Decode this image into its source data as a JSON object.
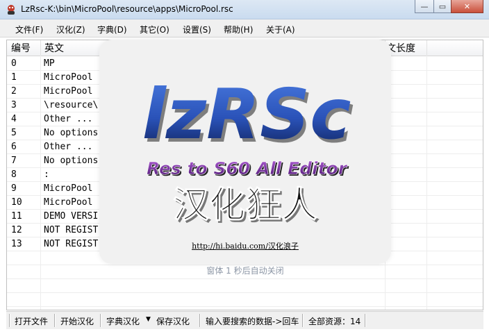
{
  "window": {
    "title": "LzRsc-K:\\bin\\MicroPool\\resource\\apps\\MicroPool.rsc",
    "icon": "lzrsc-app-icon"
  },
  "menu": [
    "文件(F)",
    "汉化(Z)",
    "字典(D)",
    "其它(O)",
    "设置(S)",
    "帮助(H)",
    "关于(A)"
  ],
  "table": {
    "headers": [
      "编号",
      "英文",
      "文长度"
    ],
    "rows": [
      {
        "id": "0",
        "en": "MP"
      },
      {
        "id": "1",
        "en": "MicroPool"
      },
      {
        "id": "2",
        "en": "MicroPool"
      },
      {
        "id": "3",
        "en": "\\resource\\"
      },
      {
        "id": "4",
        "en": "Other ..."
      },
      {
        "id": "5",
        "en": "No options"
      },
      {
        "id": "6",
        "en": "Other ..."
      },
      {
        "id": "7",
        "en": "No options"
      },
      {
        "id": "8",
        "en": ":"
      },
      {
        "id": "9",
        "en": "MicroPool"
      },
      {
        "id": "10",
        "en": "MicroPool"
      },
      {
        "id": "11",
        "en": "DEMO VERSI"
      },
      {
        "id": "12",
        "en": "NOT REGIST"
      },
      {
        "id": "13",
        "en": "NOT REGIST"
      }
    ]
  },
  "splash": {
    "logo": "lzRSc",
    "subtitle": "Res to S60 All Editor",
    "brand": "汉化狂人",
    "link": "http://hi.baidu.com/汉化浪子",
    "close_hint": "窗体 1 秒后自动关闭"
  },
  "status": {
    "open": "打开文件",
    "start": "开始汉化",
    "dict": "字典汉化",
    "save": "保存汉化",
    "search": "输入要搜索的数据->回车",
    "total": "全部资源：14"
  },
  "colors": {
    "logo_blue": "#2a52b8",
    "subtitle_purple": "#6a1f8e",
    "brand_black": "#111111"
  }
}
